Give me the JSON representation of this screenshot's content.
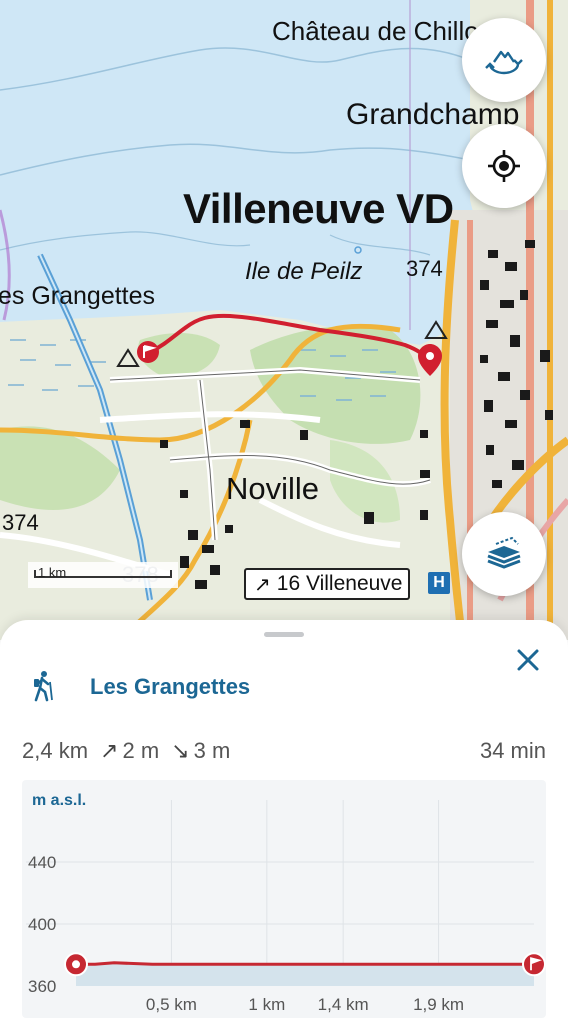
{
  "map": {
    "labels": {
      "chateau": "Château de Chillo",
      "grandchamp": "Grandchamp",
      "villeneuve": "Villeneuve VD",
      "peilz": "Ile de Peilz",
      "elev374a": "374",
      "grangettes": "es Grangettes",
      "noville": "Noville",
      "elev374b": "374",
      "elev378": "378"
    },
    "scale_label": "1 km",
    "signpost": {
      "arrow": "↗",
      "text": "16 Villeneuve"
    },
    "hospital": "H",
    "buttons": {
      "view3d": "3d-view-icon",
      "locate": "locate-icon",
      "layers": "layers-icon"
    },
    "colors": {
      "lake": "#cfe7f6",
      "land": "#e8ecdf",
      "forest": "#c5dfb1",
      "route": "#d11f2f"
    }
  },
  "sheet": {
    "activity_icon": "hiker-icon",
    "title": "Les Grangettes",
    "close_icon": "close-icon",
    "distance": "2,4 km",
    "ascent_symbol": "↗",
    "ascent": "2 m",
    "descent_symbol": "↘",
    "descent": "3 m",
    "duration": "34 min"
  },
  "chart_data": {
    "type": "area",
    "ylabel": "m a.s.l.",
    "y_ticks": [
      360,
      400,
      440
    ],
    "x_tick_labels": [
      "0,5 km",
      "1 km",
      "1,4 km",
      "1,9 km"
    ],
    "x_ticks_km": [
      0.5,
      1.0,
      1.4,
      1.9
    ],
    "ylim": [
      360,
      480
    ],
    "xlim": [
      0,
      2.4
    ],
    "x": [
      0,
      0.1,
      0.2,
      0.4,
      0.6,
      0.8,
      1.0,
      1.2,
      1.4,
      1.6,
      1.8,
      2.0,
      2.2,
      2.4
    ],
    "y": [
      374,
      374,
      375,
      374,
      374,
      374,
      374,
      374,
      374,
      374,
      374,
      374,
      374,
      374
    ],
    "line_color": "#c62832",
    "fill_color": "#d4e3ec",
    "start_marker": "start-pin-icon",
    "end_marker": "end-flag-icon"
  }
}
